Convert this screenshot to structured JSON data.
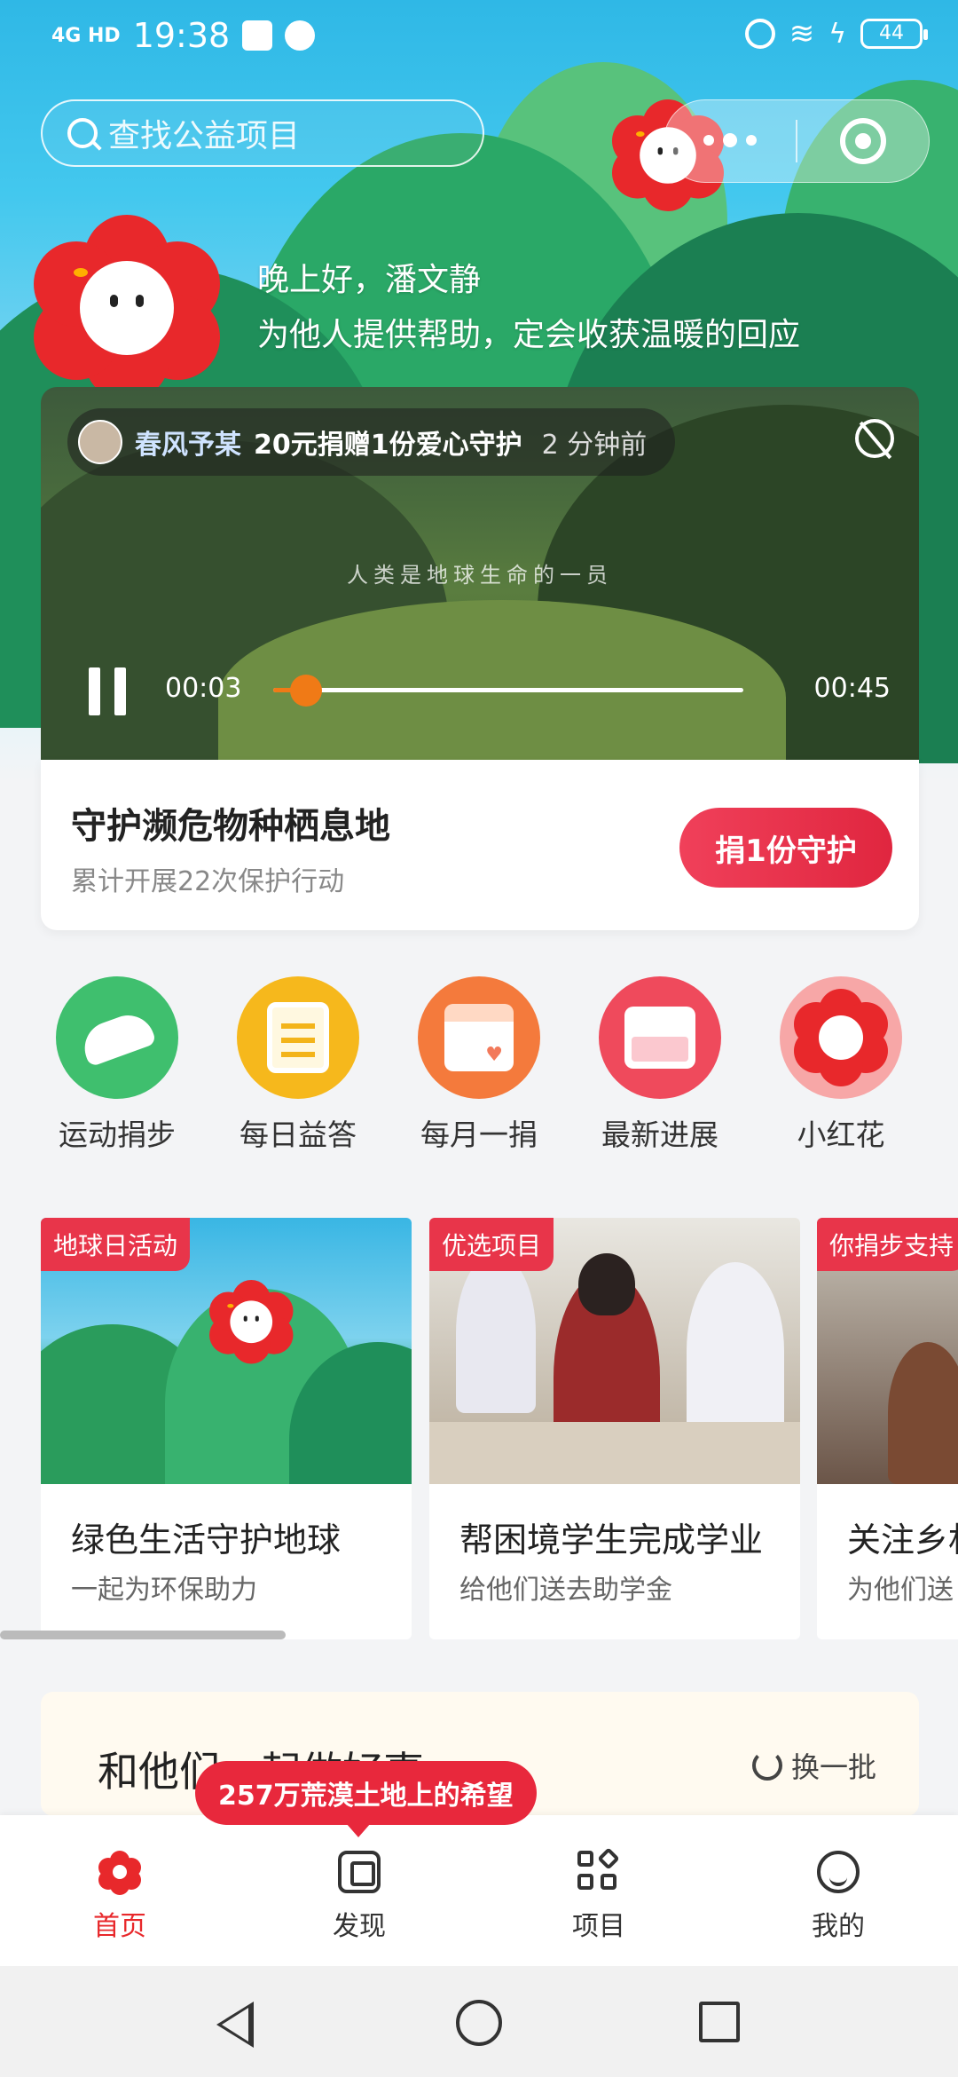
{
  "status_bar": {
    "network": "4G HD",
    "time": "19:38",
    "battery": "44"
  },
  "header": {
    "search_placeholder": "查找公益项目"
  },
  "greeting": {
    "line1": "晚上好，潘文静",
    "line2": "为他人提供帮助，定会收获温暖的回应"
  },
  "video": {
    "ticker_name": "春风予某",
    "ticker_action": "20元捐赠1份爱心守护",
    "ticker_time": "2 分钟前",
    "caption": "人类是地球生命的一员",
    "current_time": "00:03",
    "total_time": "00:45",
    "progress": 0.07
  },
  "project": {
    "title": "守护濒危物种栖息地",
    "subtitle": "累计开展22次保护行动",
    "button": "捐1份守护"
  },
  "quick_actions": [
    {
      "label": "运动捐步",
      "color": "#3fbf6e",
      "icon": "sneaker-icon"
    },
    {
      "label": "每日益答",
      "color": "#f6b81c",
      "icon": "clipboard-icon"
    },
    {
      "label": "每月一捐",
      "color": "#f47a3c",
      "icon": "calendar-icon"
    },
    {
      "label": "最新进展",
      "color": "#ef4a5c",
      "icon": "inbox-icon"
    },
    {
      "label": "小红花",
      "color": "#f7a7a7",
      "icon": "flower-icon"
    }
  ],
  "cards": [
    {
      "tag": "地球日活动",
      "title": "绿色生活守护地球",
      "subtitle": "一起为环保助力"
    },
    {
      "tag": "优选项目",
      "title": "帮困境学生完成学业",
      "subtitle": "给他们送去助学金"
    },
    {
      "tag": "你捐步支持",
      "title": "关注乡村",
      "subtitle": "为他们送"
    }
  ],
  "section": {
    "title": "和他们一起做好事",
    "refresh": "换一批"
  },
  "bubble": "257万荒漠土地上的希望",
  "tabs": [
    {
      "label": "首页",
      "active": true
    },
    {
      "label": "发现",
      "active": false
    },
    {
      "label": "项目",
      "active": false
    },
    {
      "label": "我的",
      "active": false
    }
  ],
  "colors": {
    "accent": "#e8282b",
    "progress": "#f07a16"
  }
}
